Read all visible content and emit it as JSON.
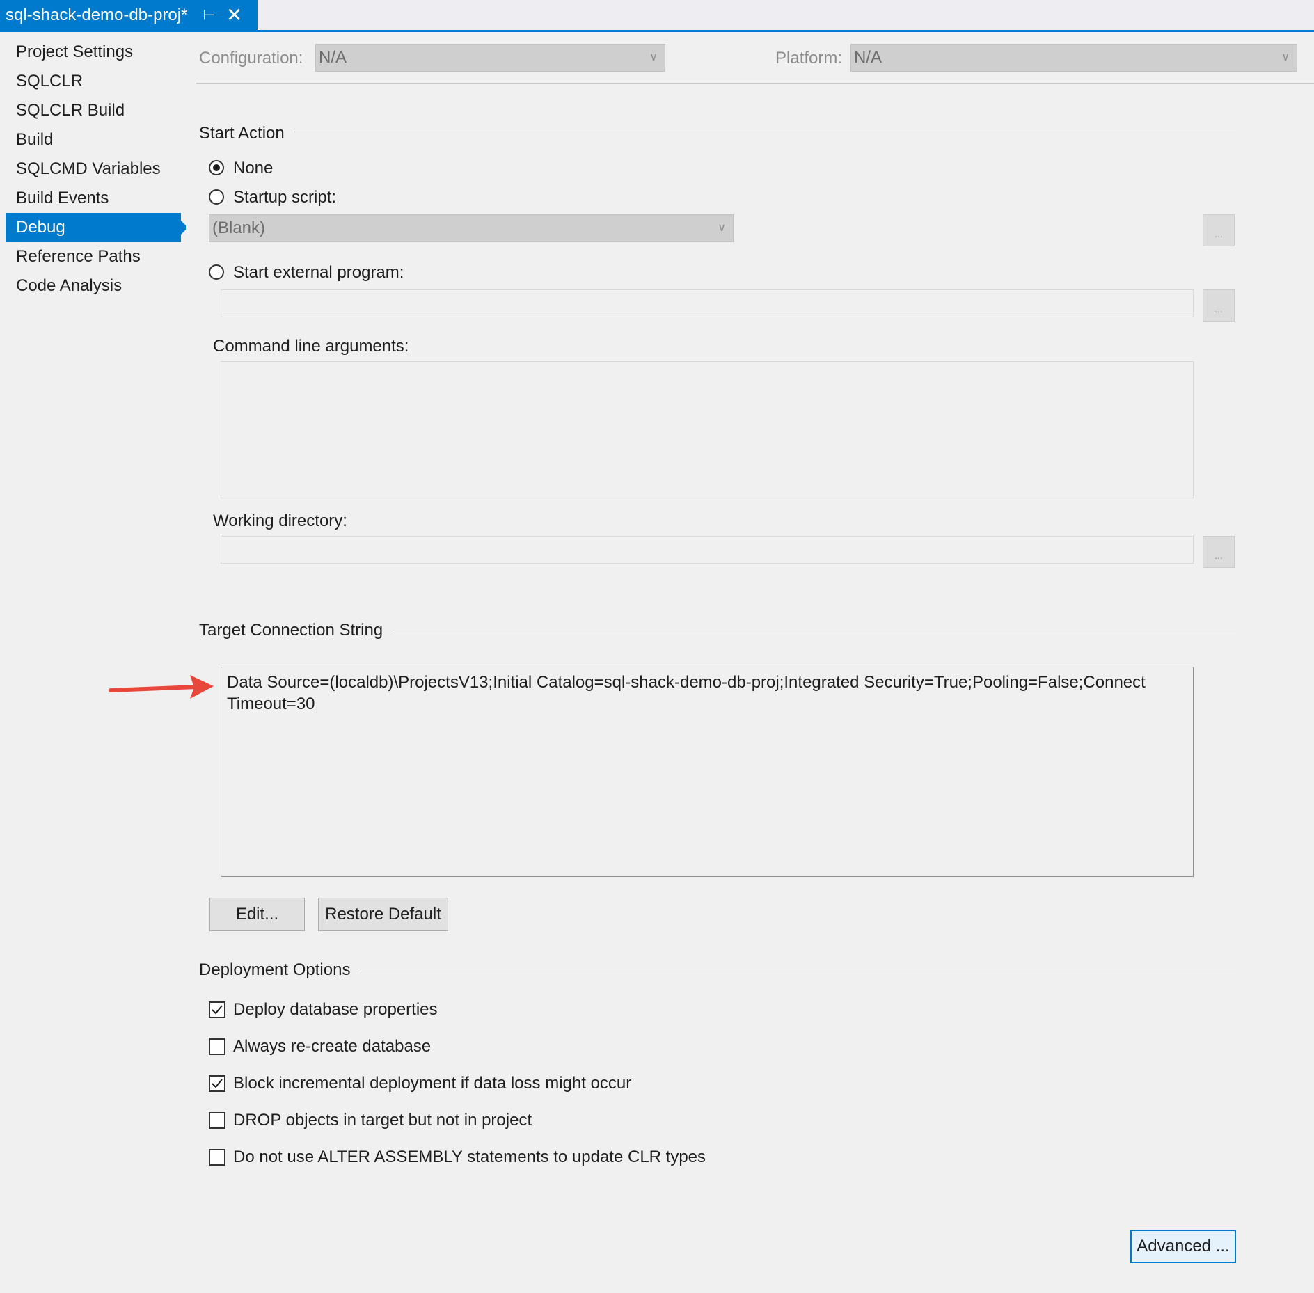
{
  "tab": {
    "title": "sql-shack-demo-db-proj*"
  },
  "nav": {
    "items": [
      {
        "label": "Project Settings"
      },
      {
        "label": "SQLCLR"
      },
      {
        "label": "SQLCLR Build"
      },
      {
        "label": "Build"
      },
      {
        "label": "SQLCMD Variables"
      },
      {
        "label": "Build Events"
      },
      {
        "label": "Debug"
      },
      {
        "label": "Reference Paths"
      },
      {
        "label": "Code Analysis"
      }
    ],
    "selected": "Debug"
  },
  "config": {
    "configuration_label": "Configuration:",
    "configuration_value": "N/A",
    "platform_label": "Platform:",
    "platform_value": "N/A"
  },
  "start_action": {
    "title": "Start Action",
    "none_label": "None",
    "startup_script_label": "Startup script:",
    "startup_script_value": "(Blank)",
    "external_program_label": "Start external program:",
    "command_line_label": "Command line arguments:",
    "working_directory_label": "Working directory:",
    "browse_label": "...",
    "selected": "None"
  },
  "target_connection": {
    "title": "Target Connection String",
    "value": "Data Source=(localdb)\\ProjectsV13;Initial Catalog=sql-shack-demo-db-proj;Integrated Security=True;Pooling=False;Connect Timeout=30",
    "edit_label": "Edit...",
    "restore_label": "Restore Default"
  },
  "deployment": {
    "title": "Deployment Options",
    "options": [
      {
        "label": "Deploy database properties",
        "checked": true
      },
      {
        "label": "Always re-create database",
        "checked": false
      },
      {
        "label": "Block incremental deployment if data loss might occur",
        "checked": true
      },
      {
        "label": "DROP objects in target but not in project",
        "checked": false
      },
      {
        "label": "Do not use ALTER ASSEMBLY statements to update CLR types",
        "checked": false
      }
    ],
    "advanced_label": "Advanced ..."
  },
  "colors": {
    "accent": "#007acc",
    "arrow": "#e8483b",
    "background": "#f0f0f0"
  }
}
